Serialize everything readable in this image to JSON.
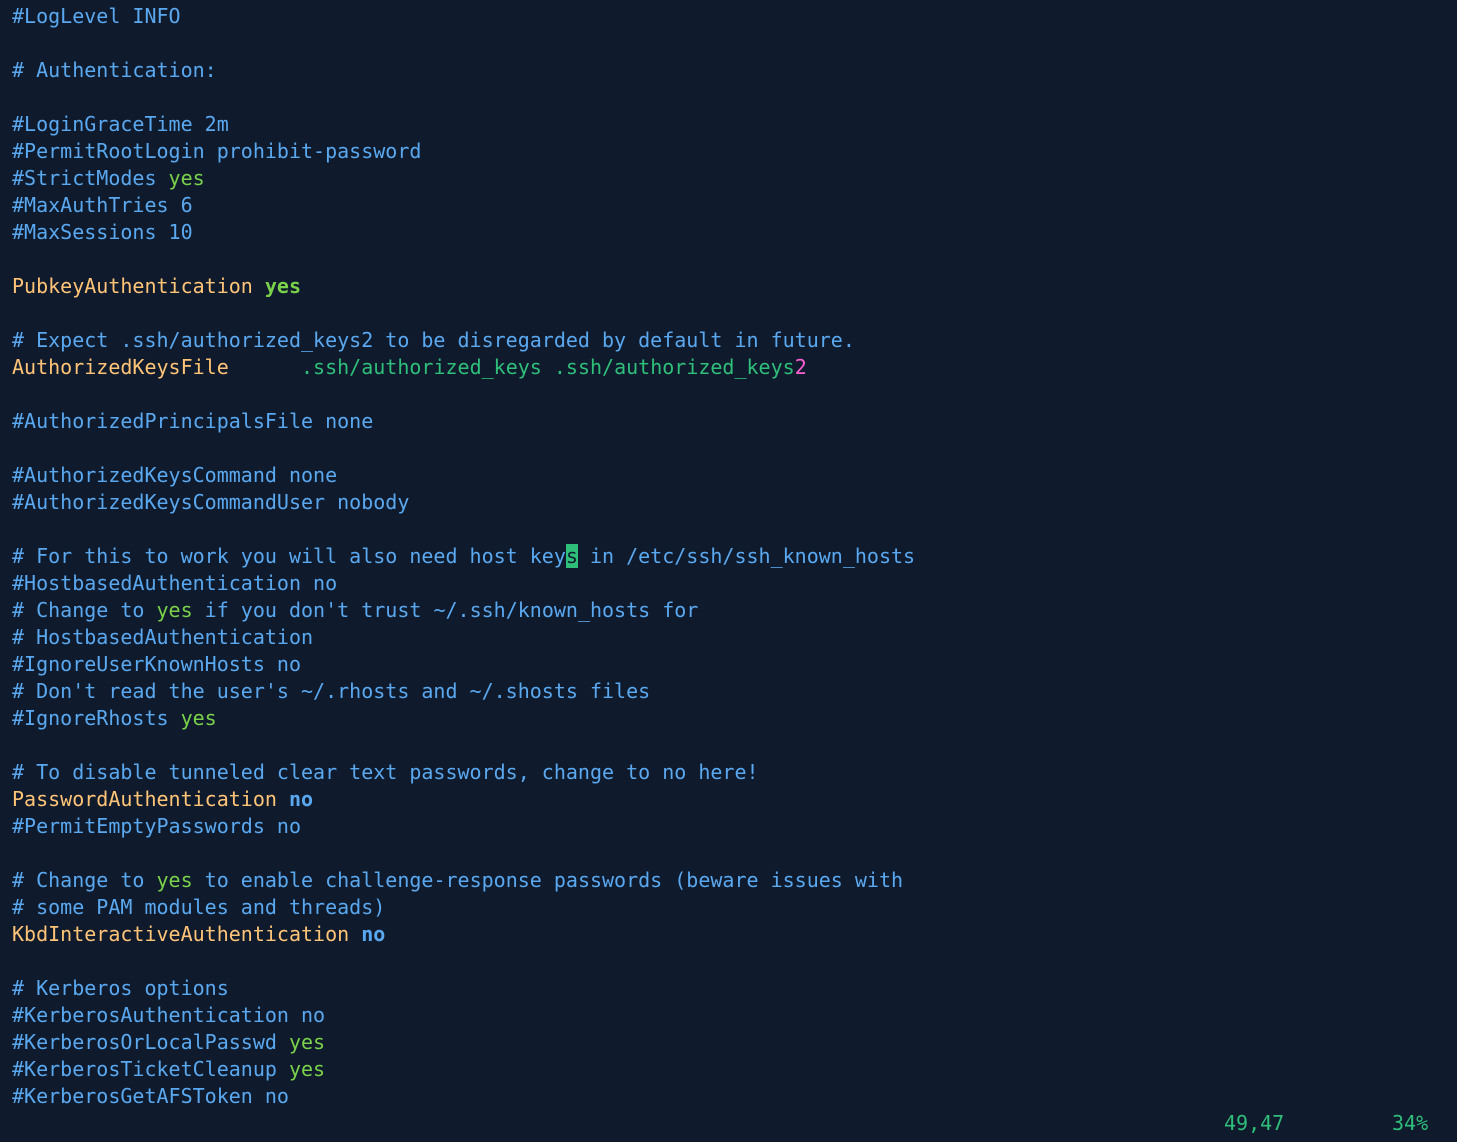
{
  "editor": {
    "lines": [
      {
        "segments": [
          {
            "text": "#LogLevel ",
            "kind": "comment"
          },
          {
            "text": "INFO",
            "kind": "comment"
          }
        ]
      },
      {
        "segments": []
      },
      {
        "segments": [
          {
            "text": "# Authentication:",
            "kind": "comment"
          }
        ]
      },
      {
        "segments": []
      },
      {
        "segments": [
          {
            "text": "#LoginGraceTime 2m",
            "kind": "comment"
          }
        ]
      },
      {
        "segments": [
          {
            "text": "#PermitRootLogin prohibit-password",
            "kind": "comment"
          }
        ]
      },
      {
        "segments": [
          {
            "text": "#StrictModes ",
            "kind": "comment"
          },
          {
            "text": "yes",
            "kind": "yes"
          }
        ]
      },
      {
        "segments": [
          {
            "text": "#MaxAuthTries 6",
            "kind": "comment"
          }
        ]
      },
      {
        "segments": [
          {
            "text": "#MaxSessions 10",
            "kind": "comment"
          }
        ]
      },
      {
        "segments": []
      },
      {
        "segments": [
          {
            "text": "PubkeyAuthentication",
            "kind": "directive"
          },
          {
            "text": " ",
            "kind": "plain"
          },
          {
            "text": "yes",
            "kind": "yes-bold"
          }
        ]
      },
      {
        "segments": []
      },
      {
        "segments": [
          {
            "text": "# Expect .ssh/authorized_keys2 to be disregarded by default in future.",
            "kind": "comment"
          }
        ]
      },
      {
        "segments": [
          {
            "text": "AuthorizedKeysFile",
            "kind": "directive"
          },
          {
            "text": "      ",
            "kind": "plain"
          },
          {
            "text": ".ssh/authorized_keys .ssh/authorized_keys",
            "kind": "path"
          },
          {
            "text": "2",
            "kind": "pink"
          }
        ]
      },
      {
        "segments": []
      },
      {
        "segments": [
          {
            "text": "#AuthorizedPrincipalsFile none",
            "kind": "comment"
          }
        ]
      },
      {
        "segments": []
      },
      {
        "segments": [
          {
            "text": "#AuthorizedKeysCommand none",
            "kind": "comment"
          }
        ]
      },
      {
        "segments": [
          {
            "text": "#AuthorizedKeysCommandUser nobody",
            "kind": "comment"
          }
        ]
      },
      {
        "segments": []
      },
      {
        "segments": [
          {
            "text": "# For this to work you will also need host key",
            "kind": "comment"
          },
          {
            "text": "s",
            "kind": "cursor"
          },
          {
            "text": " in /etc/ssh/ssh_known_hosts",
            "kind": "comment"
          }
        ]
      },
      {
        "segments": [
          {
            "text": "#HostbasedAuthentication no",
            "kind": "comment"
          }
        ]
      },
      {
        "segments": [
          {
            "text": "# Change to ",
            "kind": "comment"
          },
          {
            "text": "yes",
            "kind": "yes"
          },
          {
            "text": " if you don't trust ~/.ssh/known_hosts for",
            "kind": "comment"
          }
        ]
      },
      {
        "segments": [
          {
            "text": "# HostbasedAuthentication",
            "kind": "comment"
          }
        ]
      },
      {
        "segments": [
          {
            "text": "#IgnoreUserKnownHosts no",
            "kind": "comment"
          }
        ]
      },
      {
        "segments": [
          {
            "text": "# Don't read the user's ~/.rhosts and ~/.shosts files",
            "kind": "comment"
          }
        ]
      },
      {
        "segments": [
          {
            "text": "#IgnoreRhosts ",
            "kind": "comment"
          },
          {
            "text": "yes",
            "kind": "yes"
          }
        ]
      },
      {
        "segments": []
      },
      {
        "segments": [
          {
            "text": "# To disable tunneled clear text passwords, change to no here!",
            "kind": "comment"
          }
        ]
      },
      {
        "segments": [
          {
            "text": "PasswordAuthentication",
            "kind": "directive"
          },
          {
            "text": " ",
            "kind": "plain"
          },
          {
            "text": "no",
            "kind": "no-bold"
          }
        ]
      },
      {
        "segments": [
          {
            "text": "#PermitEmptyPasswords no",
            "kind": "comment"
          }
        ]
      },
      {
        "segments": []
      },
      {
        "segments": [
          {
            "text": "# Change to ",
            "kind": "comment"
          },
          {
            "text": "yes",
            "kind": "yes"
          },
          {
            "text": " to enable challenge-response passwords (beware issues with",
            "kind": "comment"
          }
        ]
      },
      {
        "segments": [
          {
            "text": "# some PAM modules and threads)",
            "kind": "comment"
          }
        ]
      },
      {
        "segments": [
          {
            "text": "KbdInteractiveAuthentication",
            "kind": "directive"
          },
          {
            "text": " ",
            "kind": "plain"
          },
          {
            "text": "no",
            "kind": "no-bold"
          }
        ]
      },
      {
        "segments": []
      },
      {
        "segments": [
          {
            "text": "# Kerberos options",
            "kind": "comment"
          }
        ]
      },
      {
        "segments": [
          {
            "text": "#KerberosAuthentication no",
            "kind": "comment"
          }
        ]
      },
      {
        "segments": [
          {
            "text": "#KerberosOrLocalPasswd ",
            "kind": "comment"
          },
          {
            "text": "yes",
            "kind": "yes"
          }
        ]
      },
      {
        "segments": [
          {
            "text": "#KerberosTicketCleanup ",
            "kind": "comment"
          },
          {
            "text": "yes",
            "kind": "yes"
          }
        ]
      },
      {
        "segments": [
          {
            "text": "#KerberosGetAFSToken no",
            "kind": "comment"
          }
        ]
      }
    ]
  },
  "status": {
    "position": "49,47",
    "percent": "34%"
  },
  "colors": {
    "background": "#0f1b2d",
    "comment": "#5aa8f0",
    "directive": "#ffc477",
    "yes": "#7ad14a",
    "path": "#2fbf7a",
    "pink": "#ff5fd2",
    "cursor": "#2fbf7a"
  }
}
